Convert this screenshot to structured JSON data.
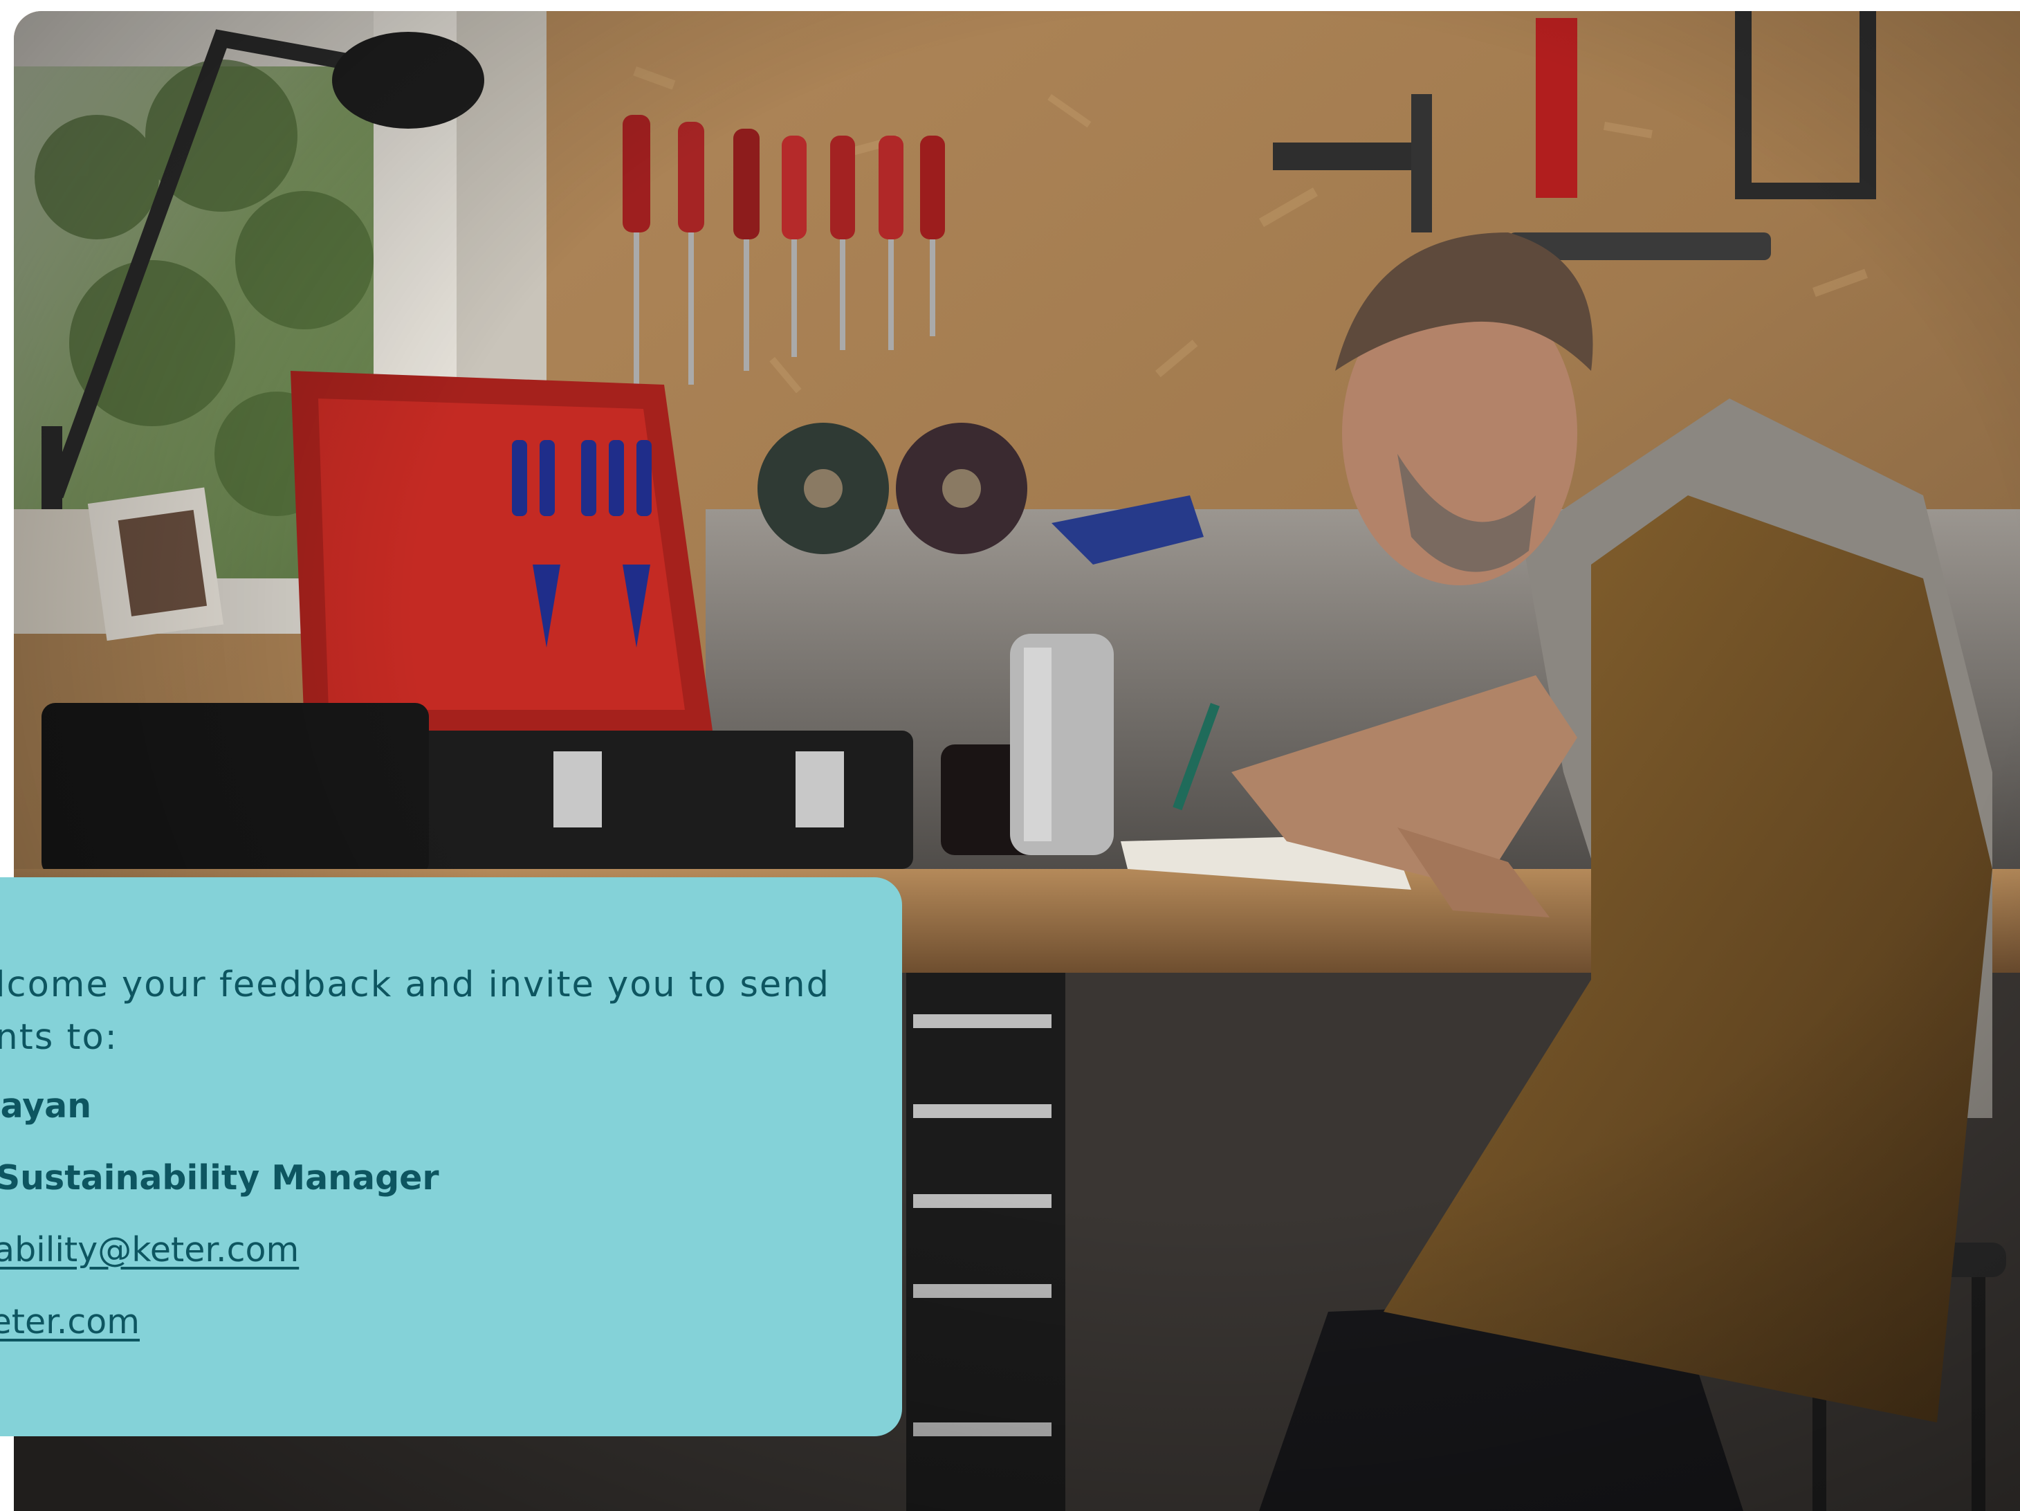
{
  "photo": {
    "description_icon": "workshop-photo"
  },
  "contact_card": {
    "intro": "elcome your feedback and invite you to send\nents to:",
    "name": "Dayan",
    "role": "l Sustainability Manager",
    "email": "nability@keter.com",
    "website": "keter.com"
  },
  "colors": {
    "card_background": "#84d2d8",
    "card_text": "#0d5560"
  }
}
